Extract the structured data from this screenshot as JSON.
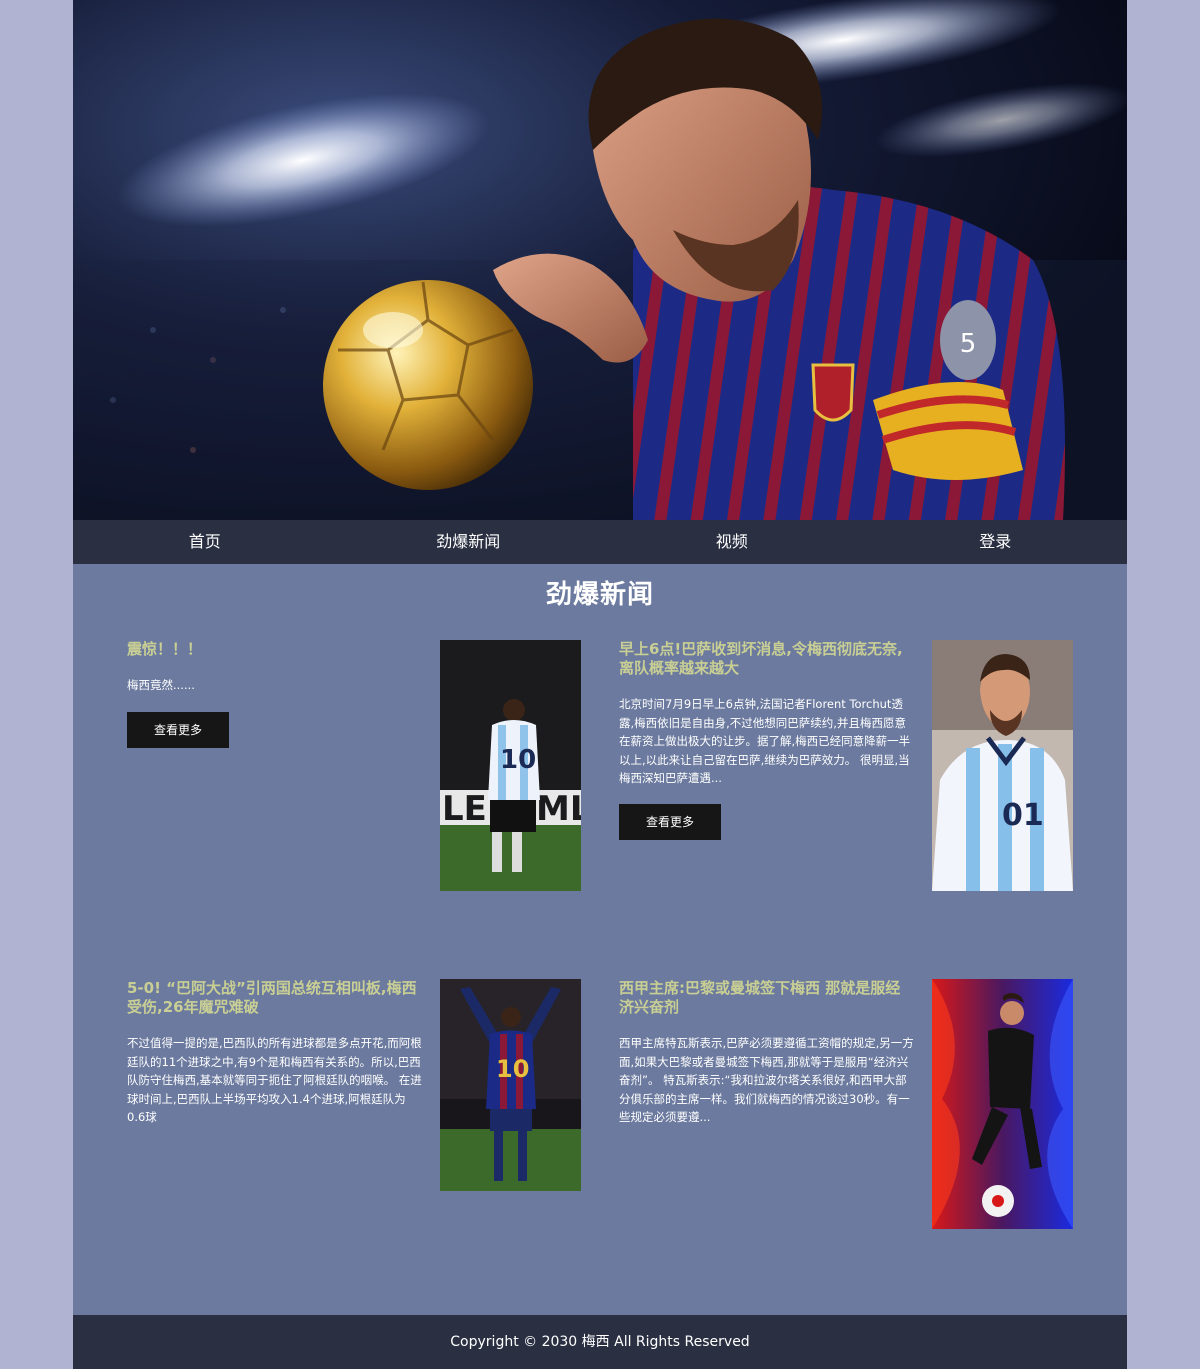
{
  "nav": {
    "items": [
      "首页",
      "劲爆新闻",
      "视频",
      "登录"
    ]
  },
  "section": {
    "title": "劲爆新闻"
  },
  "articles": [
    {
      "title": "震惊！！！",
      "desc": "梅西竟然......",
      "button": "查看更多"
    },
    {
      "title": "早上6点!巴萨收到坏消息,令梅西彻底无奈,离队概率越来越大",
      "desc": "北京时间7月9日早上6点钟,法国记者Florent Torchut透露,梅西依旧是自由身,不过他想同巴萨续约,并且梅西愿意在薪资上做出极大的让步。据了解,梅西已经同意降薪一半以上,以此来让自己留在巴萨,继续为巴萨效力。 很明显,当梅西深知巴萨遭遇...",
      "button": "查看更多"
    },
    {
      "title": "5-0! “巴阿大战”引两国总统互相叫板,梅西受伤,26年魔咒难破",
      "desc": "不过值得一提的是,巴西队的所有进球都是多点开花,而阿根廷队的11个进球之中,有9个是和梅西有关系的。所以,巴西队防守住梅西,基本就等同于扼住了阿根廷队的咽喉。 在进球时间上,巴西队上半场平均攻入1.4个进球,阿根廷队为0.6球"
    },
    {
      "title": "西甲主席:巴黎或曼城签下梅西 那就是服经济兴奋剂",
      "desc": "西甲主席特瓦斯表示,巴萨必须要遵循工资帽的规定,另一方面,如果大巴黎或者曼城签下梅西,那就等于是服用“经济兴奋剂”。 特瓦斯表示:“我和拉波尔塔关系很好,和西甲大部分俱乐部的主席一样。我们就梅西的情况谈过30秒。有一些规定必须要遵..."
    }
  ],
  "footer": {
    "text": "Copyright © 2030 梅西 All Rights Reserved"
  },
  "colors": {
    "page_bg": "#b1b3d3",
    "content_bg": "#6b7a9e",
    "nav_bg": "#2a3042",
    "title_accent": "#c9cf94",
    "button_bg": "#161616"
  },
  "icons": {
    "hero": "hero-player-with-golden-ball-image",
    "thumbs": [
      "player-back-view-image",
      "player-argentina-jersey-image",
      "player-arms-raised-image",
      "player-fire-art-image"
    ]
  }
}
